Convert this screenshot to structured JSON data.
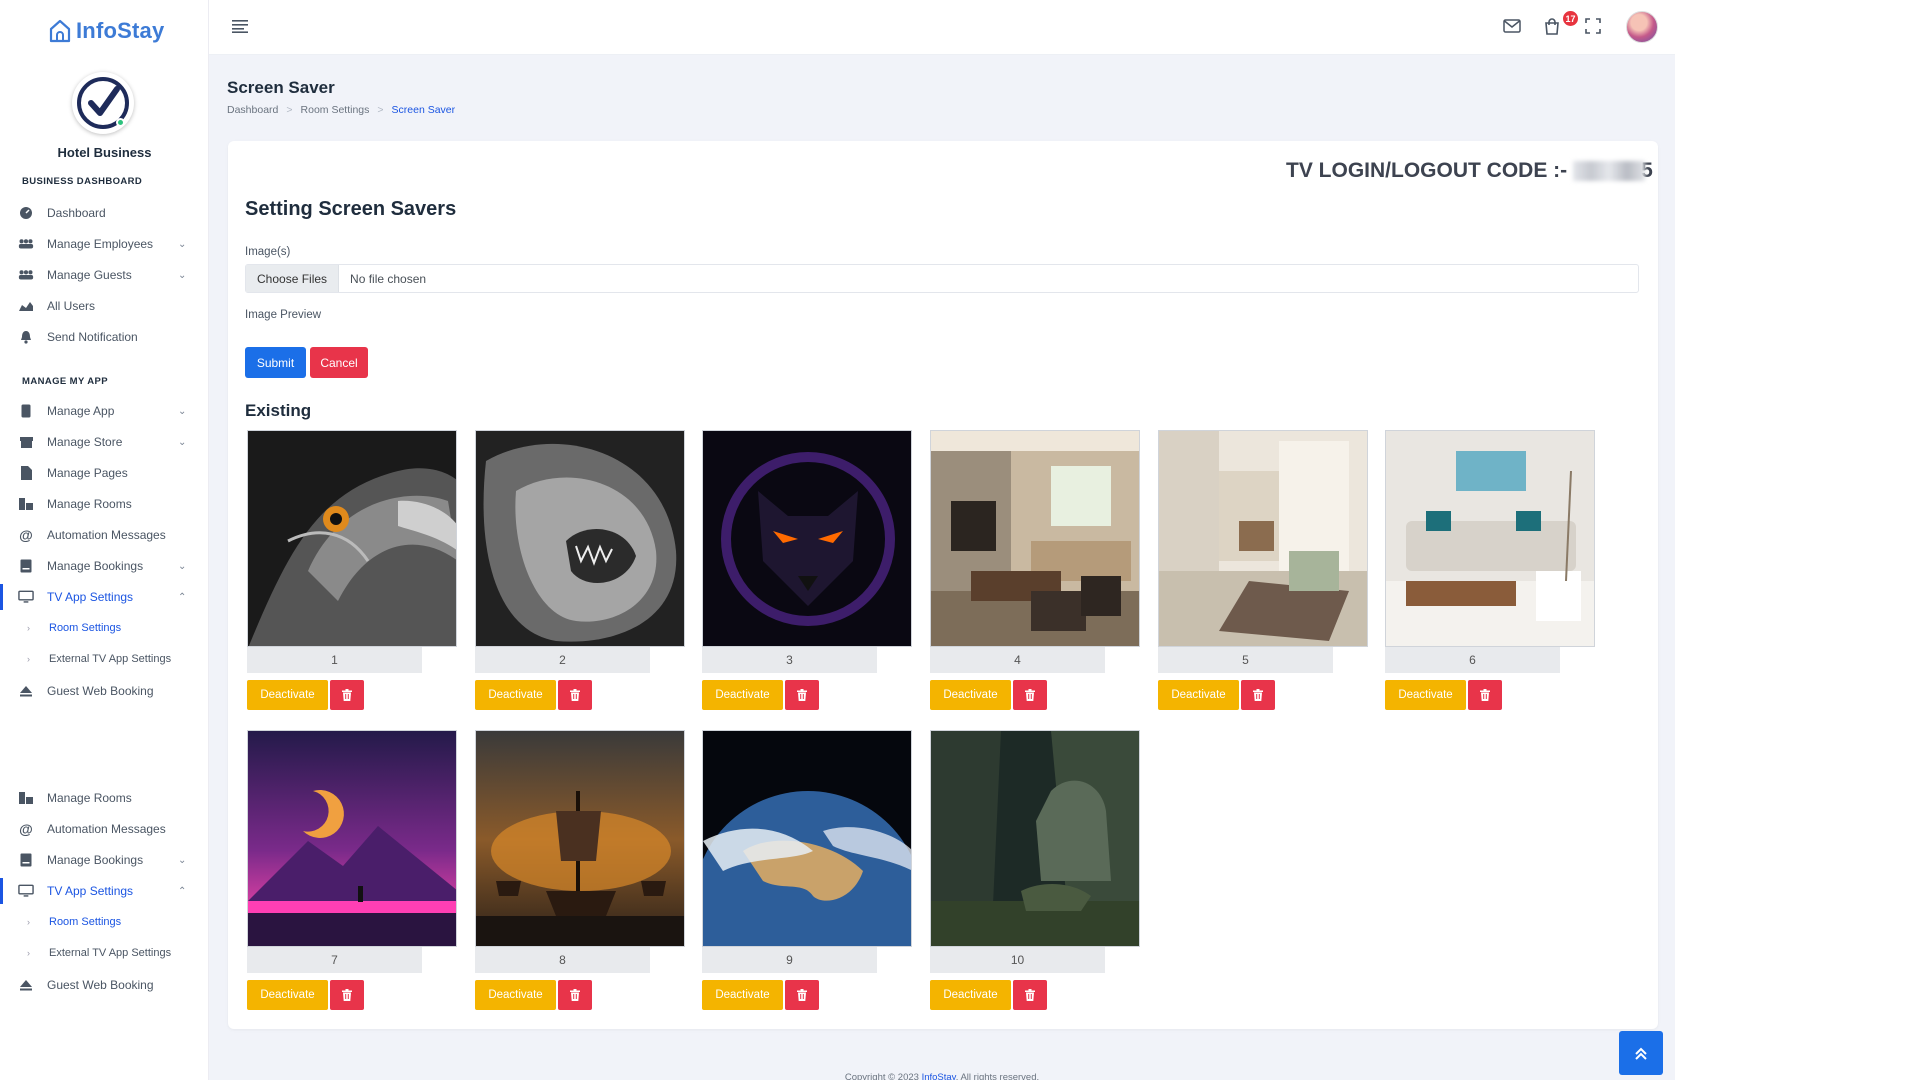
{
  "app": {
    "name": "InfoStay"
  },
  "business": {
    "name": "Hotel Business"
  },
  "sidebar": {
    "section_dashboard": "BUSINESS DASHBOARD",
    "section_app": "MANAGE MY APP",
    "items": [
      {
        "label": "Dashboard",
        "icon": "dashboard-icon"
      },
      {
        "label": "Manage Employees",
        "icon": "users-icon"
      },
      {
        "label": "Manage Guests",
        "icon": "users-icon"
      },
      {
        "label": "All Users",
        "icon": "chart-icon"
      },
      {
        "label": "Send Notification",
        "icon": "bell-icon"
      },
      {
        "label": "Manage App",
        "icon": "phone-icon"
      },
      {
        "label": "Manage Store",
        "icon": "store-icon"
      },
      {
        "label": "Manage Pages",
        "icon": "file-icon"
      },
      {
        "label": "Manage Rooms",
        "icon": "rooms-icon"
      },
      {
        "label": "Automation Messages",
        "icon": "at-icon"
      },
      {
        "label": "Manage Bookings",
        "icon": "book-icon"
      },
      {
        "label": "TV App Settings",
        "icon": "tv-icon"
      },
      {
        "label": "Room Settings"
      },
      {
        "label": "External TV App Settings"
      },
      {
        "label": "Guest Web Booking",
        "icon": "eject-icon"
      },
      {
        "label": "Manage Rooms",
        "icon": "rooms-icon"
      },
      {
        "label": "Automation Messages",
        "icon": "at-icon"
      },
      {
        "label": "Manage Bookings",
        "icon": "book-icon"
      },
      {
        "label": "TV App Settings",
        "icon": "tv-icon"
      },
      {
        "label": "Room Settings"
      },
      {
        "label": "External TV App Settings"
      },
      {
        "label": "Guest Web Booking",
        "icon": "eject-icon"
      }
    ]
  },
  "topbar": {
    "cart_count": "17"
  },
  "page": {
    "title": "Screen Saver",
    "breadcrumb": [
      "Dashboard",
      "Room Settings",
      "Screen Saver"
    ]
  },
  "card": {
    "tv_code_label": "TV LOGIN/LOGOUT CODE :-",
    "tv_code_tail": "5",
    "title": "Setting Screen Savers",
    "images_label": "Image(s)",
    "choose_files": "Choose Files",
    "no_file": "No file chosen",
    "preview_label": "Image Preview",
    "submit": "Submit",
    "cancel": "Cancel",
    "existing": "Existing",
    "deactivate": "Deactivate"
  },
  "screensavers": [
    {
      "num": "1",
      "theme": "eagle"
    },
    {
      "num": "2",
      "theme": "lion"
    },
    {
      "num": "3",
      "theme": "panther"
    },
    {
      "num": "4",
      "theme": "living-room"
    },
    {
      "num": "5",
      "theme": "hallway"
    },
    {
      "num": "6",
      "theme": "lounge"
    },
    {
      "num": "7",
      "theme": "neon-mountain"
    },
    {
      "num": "8",
      "theme": "pirate-ships"
    },
    {
      "num": "9",
      "theme": "earth"
    },
    {
      "num": "10",
      "theme": "jungle-statue"
    }
  ],
  "footer": {
    "prefix": "Copyright © 2023 ",
    "brand": "InfoStay",
    "suffix": ". All rights reserved."
  },
  "colors": {
    "primary": "#1b6fe8",
    "danger": "#e8344a",
    "warning": "#f4b400",
    "brand": "#3d7bd6"
  }
}
